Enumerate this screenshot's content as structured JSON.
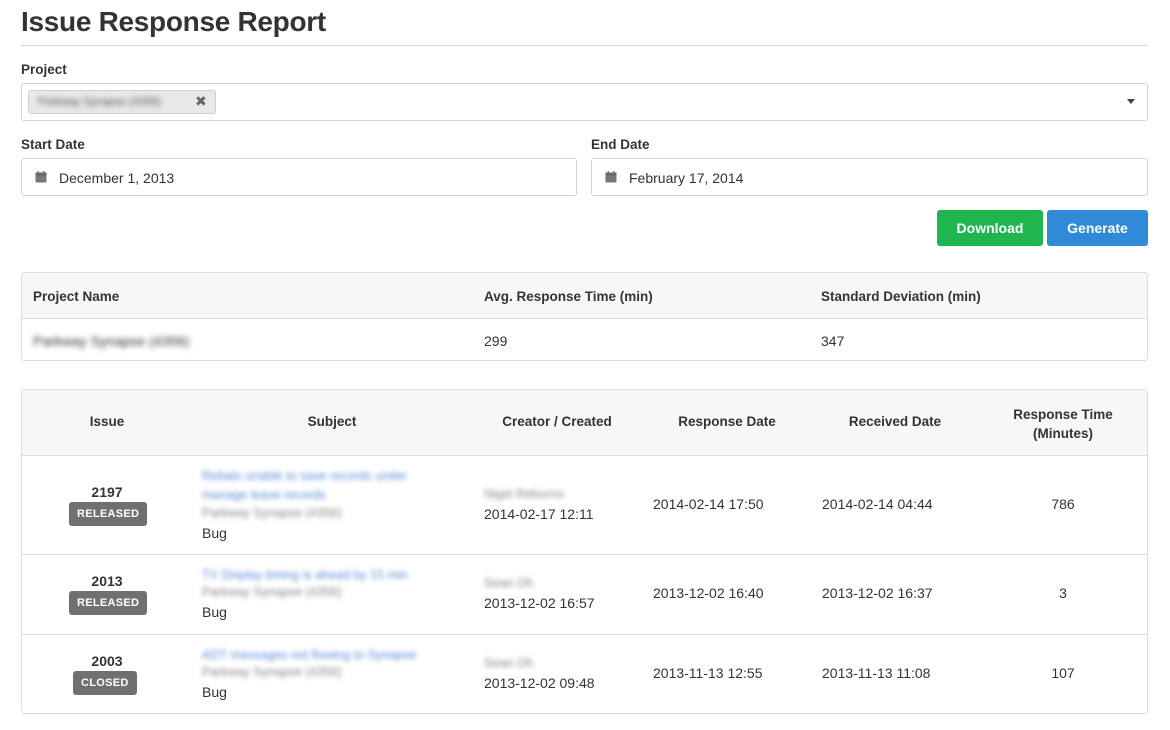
{
  "page": {
    "title": "Issue Response Report"
  },
  "project_field": {
    "label": "Project",
    "selected": [
      {
        "text": "Parkway Synapse (4356)",
        "remove_icon": "close-icon"
      }
    ]
  },
  "start_date": {
    "label": "Start Date",
    "value": "December 1, 2013",
    "icon": "calendar-icon"
  },
  "end_date": {
    "label": "End Date",
    "value": "February 17, 2014",
    "icon": "calendar-icon"
  },
  "actions": {
    "download_label": "Download",
    "generate_label": "Generate"
  },
  "colors": {
    "download": "#1fb650",
    "generate": "#2f8ad8",
    "badge": "#707070",
    "link": "#5b8fd6"
  },
  "summary": {
    "headers": [
      "Project Name",
      "Avg. Response Time (min)",
      "Standard Deviation (min)"
    ],
    "row": {
      "project_name": "Parkway Synapse (4356)",
      "avg_response": "299",
      "std_dev": "347"
    }
  },
  "issues": {
    "headers": [
      "Issue",
      "Subject",
      "Creator / Created",
      "Response Date",
      "Received Date",
      "Response Time (Minutes)"
    ],
    "rows": [
      {
        "issue": "2197",
        "status": "RELEASED",
        "subject": "Rebalo unable to save records under manage leave records",
        "project": "Parkway Synapse (4356)",
        "type": "Bug",
        "creator": "Nigel Reburno",
        "created": "2014-02-17 12:11",
        "response_date": "2014-02-14 17:50",
        "received_date": "2014-02-14 04:44",
        "response_time": "786"
      },
      {
        "issue": "2013",
        "status": "RELEASED",
        "subject": "TV Display timing is ahead by 15 min",
        "project": "Parkway Synapse (4356)",
        "type": "Bug",
        "creator": "Sean Oh",
        "created": "2013-12-02 16:57",
        "response_date": "2013-12-02 16:40",
        "received_date": "2013-12-02 16:37",
        "response_time": "3"
      },
      {
        "issue": "2003",
        "status": "CLOSED",
        "subject": "ADT messages not flowing to Synapse",
        "project": "Parkway Synapse (4356)",
        "type": "Bug",
        "creator": "Sean Oh",
        "created": "2013-12-02 09:48",
        "response_date": "2013-11-13 12:55",
        "received_date": "2013-11-13 11:08",
        "response_time": "107"
      }
    ]
  }
}
